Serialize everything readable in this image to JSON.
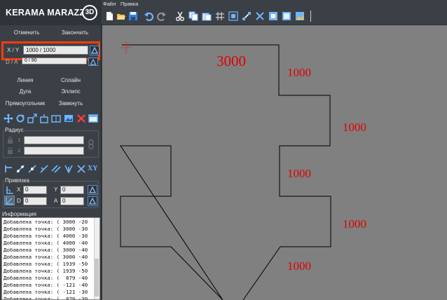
{
  "brand": {
    "name": "KERAMA MARAZZI",
    "badge": "3D"
  },
  "menu": {
    "file": "Файл",
    "edit": "Правка"
  },
  "actions": {
    "undo": "Отменить",
    "finish": "Закончить"
  },
  "coords": {
    "xy_label": "X / Y",
    "xy_value": "1000 / 1000",
    "da_label": "D / A",
    "da_value": "0 / 90"
  },
  "tools": {
    "line": "Линия",
    "spline": "Сплайн",
    "arc": "Дуга",
    "ellipse": "Эллипс",
    "rect": "Прямоугольник",
    "close": "Замкнуть"
  },
  "radius": {
    "title": "Радиус",
    "n1": "1",
    "n2": "2"
  },
  "snap": {
    "title": "Привязка",
    "x_label": "X",
    "x_value": "0",
    "y_label": "Y",
    "y_value": "0",
    "d_label": "D",
    "d_value": "0",
    "a_label": "A",
    "a_value": "0",
    "xy_icon_text": "XY"
  },
  "info": {
    "title": "Информация",
    "log": [
      "Добавлена точка: ( 3000 -20",
      "Добавлена точка: ( 3000 -30",
      "Добавлена точка: ( 4000 -30",
      "Добавлена точка: ( 4000 -40",
      "Добавлена точка: ( 3000 -40",
      "Добавлена точка: ( 3000 -40",
      "Добавлена точка: ( 1939 -50",
      "Добавлена точка: ( 1939 -50",
      "Добавлена точка: (  879 -40",
      "Добавлена точка: ( -121 -40",
      "Добавлена точка: ( -121 -30",
      "Добавлена точка: (  879 -30"
    ]
  },
  "canvas": {
    "dim_top": "3000",
    "dim_1": "1000",
    "dim_2": "1000",
    "dim_3": "1000",
    "dim_4": "1000",
    "dim_5": "1000"
  },
  "colors": {
    "highlight": "#ff3c0a",
    "dimension_text": "#e00000",
    "canvas_bg": "#808080",
    "panel_bg": "#3b4046"
  }
}
